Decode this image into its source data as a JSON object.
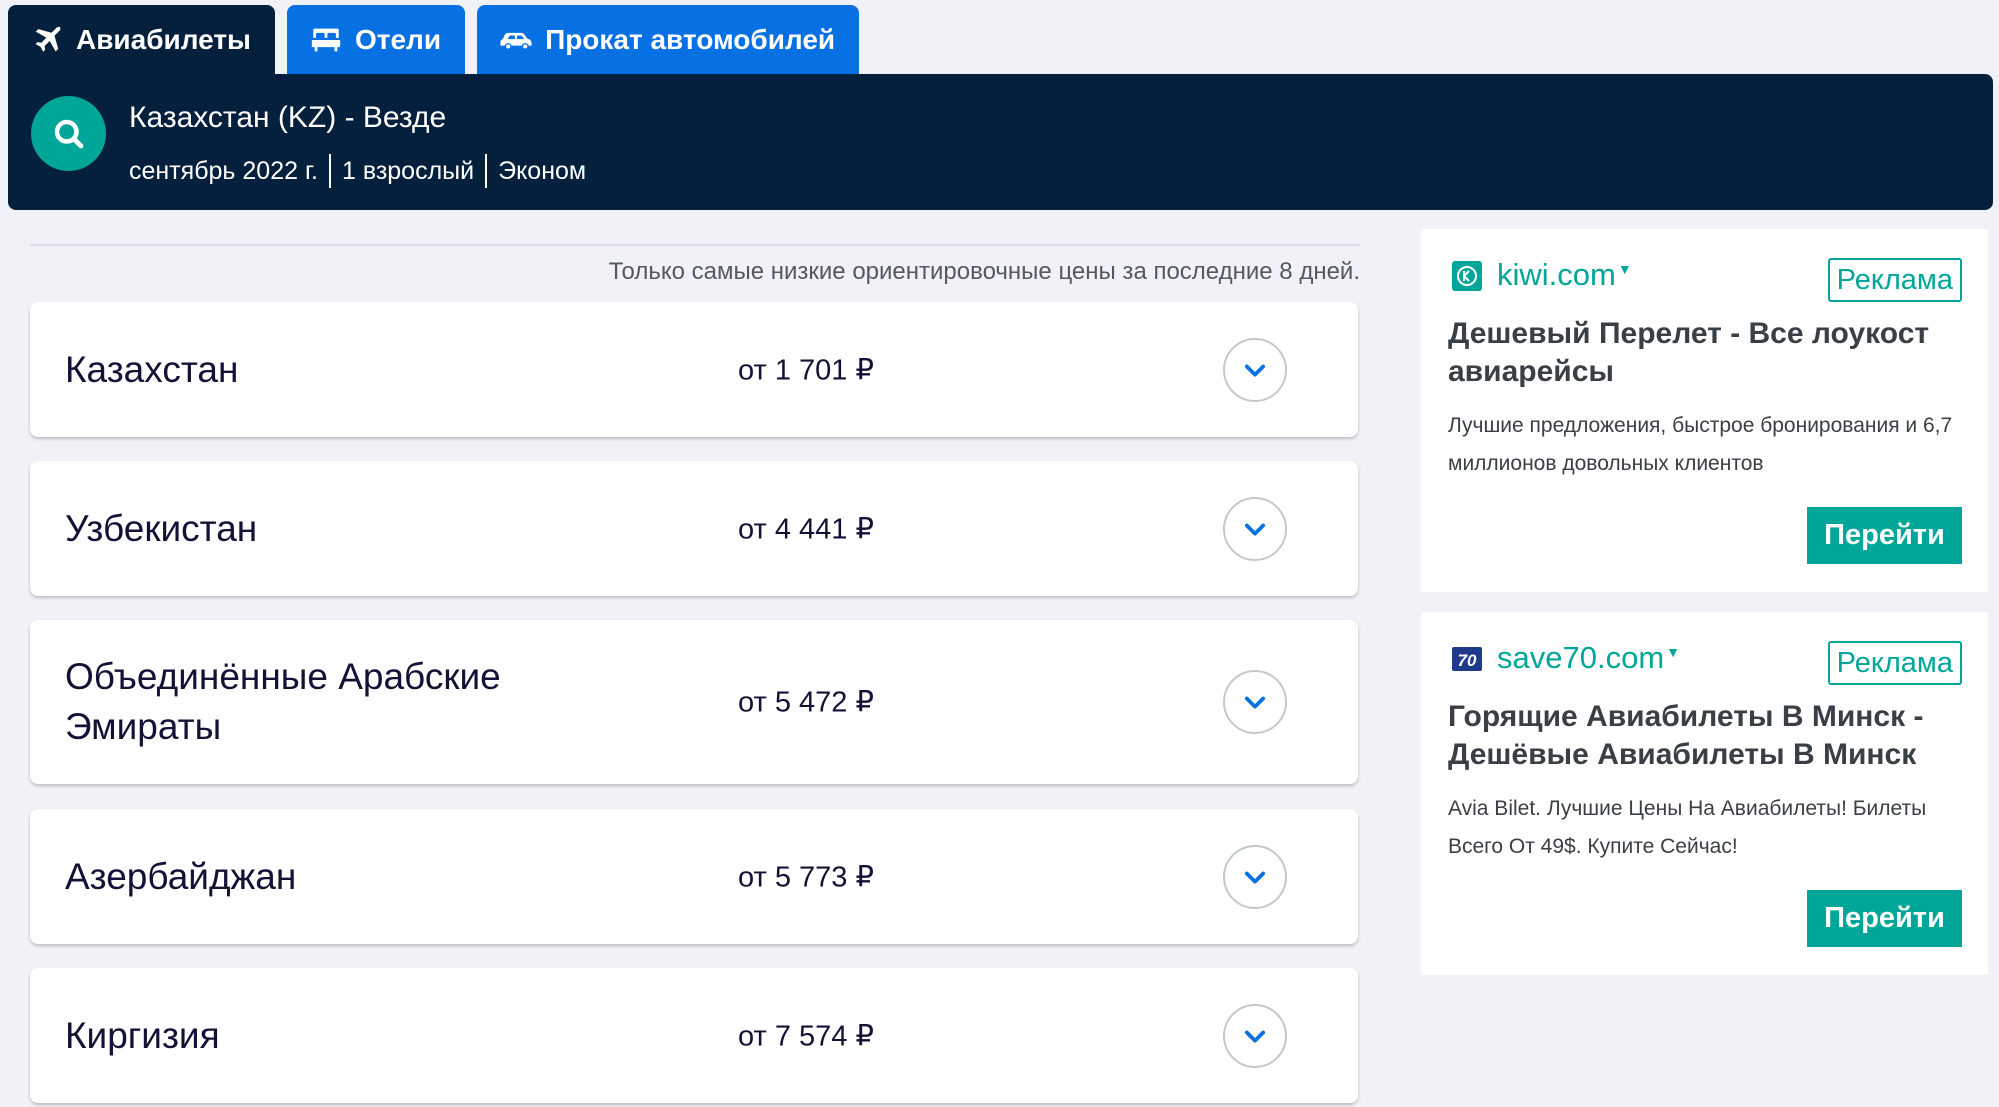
{
  "tabs": [
    {
      "label": "Авиабилеты",
      "icon": "plane-icon",
      "active": true
    },
    {
      "label": "Отели",
      "icon": "bed-icon",
      "active": false
    },
    {
      "label": "Прокат автомобилей",
      "icon": "car-icon",
      "active": false
    }
  ],
  "search": {
    "route": "Казахстан (KZ) - Везде",
    "date": "сентябрь 2022 г.",
    "travellers": "1 взрослый",
    "cabin": "Эконом",
    "icon": "search-icon"
  },
  "results": {
    "disclaimer": "Только самые низкие ориентировочные цены за последние 8 дней.",
    "items": [
      {
        "country": "Казахстан",
        "price": "от 1 701 ₽"
      },
      {
        "country": "Узбекистан",
        "price": "от 4 441 ₽"
      },
      {
        "country": "Объединённые Арабские Эмираты",
        "price": "от 5 472 ₽"
      },
      {
        "country": "Азербайджан",
        "price": "от 5 773 ₽"
      },
      {
        "country": "Киргизия",
        "price": "от 7 574 ₽"
      }
    ]
  },
  "ads": [
    {
      "domain": "kiwi.com",
      "badge": "Реклама",
      "title": "Дешевый Перелет - Все лоукост авиарейсы",
      "description": "Лучшие предложения, быстрое бронирования и 6,7 миллионов довольных клиентов",
      "button": "Перейти",
      "logo": "kiwi-logo-icon"
    },
    {
      "domain": "save70.com",
      "badge": "Реклама",
      "title": "Горящие Авиабилеты В Минск - Дешёвые Авиабилеты В Минск",
      "description": "Avia Bilet. Лучшие Цены На Авиабилеты! Билеты Всего От 49$. Купите Сейчас!",
      "button": "Перейти",
      "logo": "save70-logo-icon",
      "logo_text": "70"
    }
  ],
  "colors": {
    "navy": "#05203c",
    "blue": "#0770e3",
    "teal": "#00a698",
    "background": "#f1f2f8"
  }
}
